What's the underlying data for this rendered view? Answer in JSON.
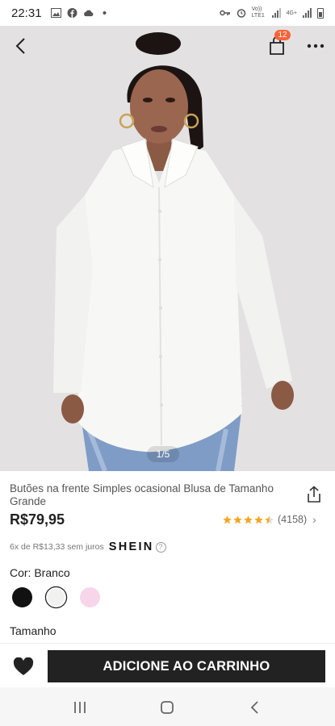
{
  "status_bar": {
    "time": "22:31",
    "network_label": "Vo)) LTE1",
    "network_type": "4G+"
  },
  "header": {
    "bag_count": "12",
    "image_counter": "1/5"
  },
  "product": {
    "title": "Butões na frente Simples ocasional Blusa de Tamanho Grande",
    "price": "R$79,95",
    "rating_count": "(4158)",
    "rating_value": 4.5,
    "installments": "6x de R$13,33 sem juros",
    "brand": "SHEIN",
    "color_label": "Cor: Branco",
    "size_label": "Tamanho",
    "swatches": [
      {
        "name": "black",
        "color": "#111111"
      },
      {
        "name": "white",
        "color": "#f1f1ef",
        "selected": true
      },
      {
        "name": "pink",
        "color": "#f7d6ea"
      }
    ]
  },
  "actions": {
    "add_to_cart": "ADICIONE AO CARRINHO"
  },
  "colors": {
    "accent_badge": "#fa6338",
    "star": "#f5a623",
    "button_bg": "#222222"
  }
}
